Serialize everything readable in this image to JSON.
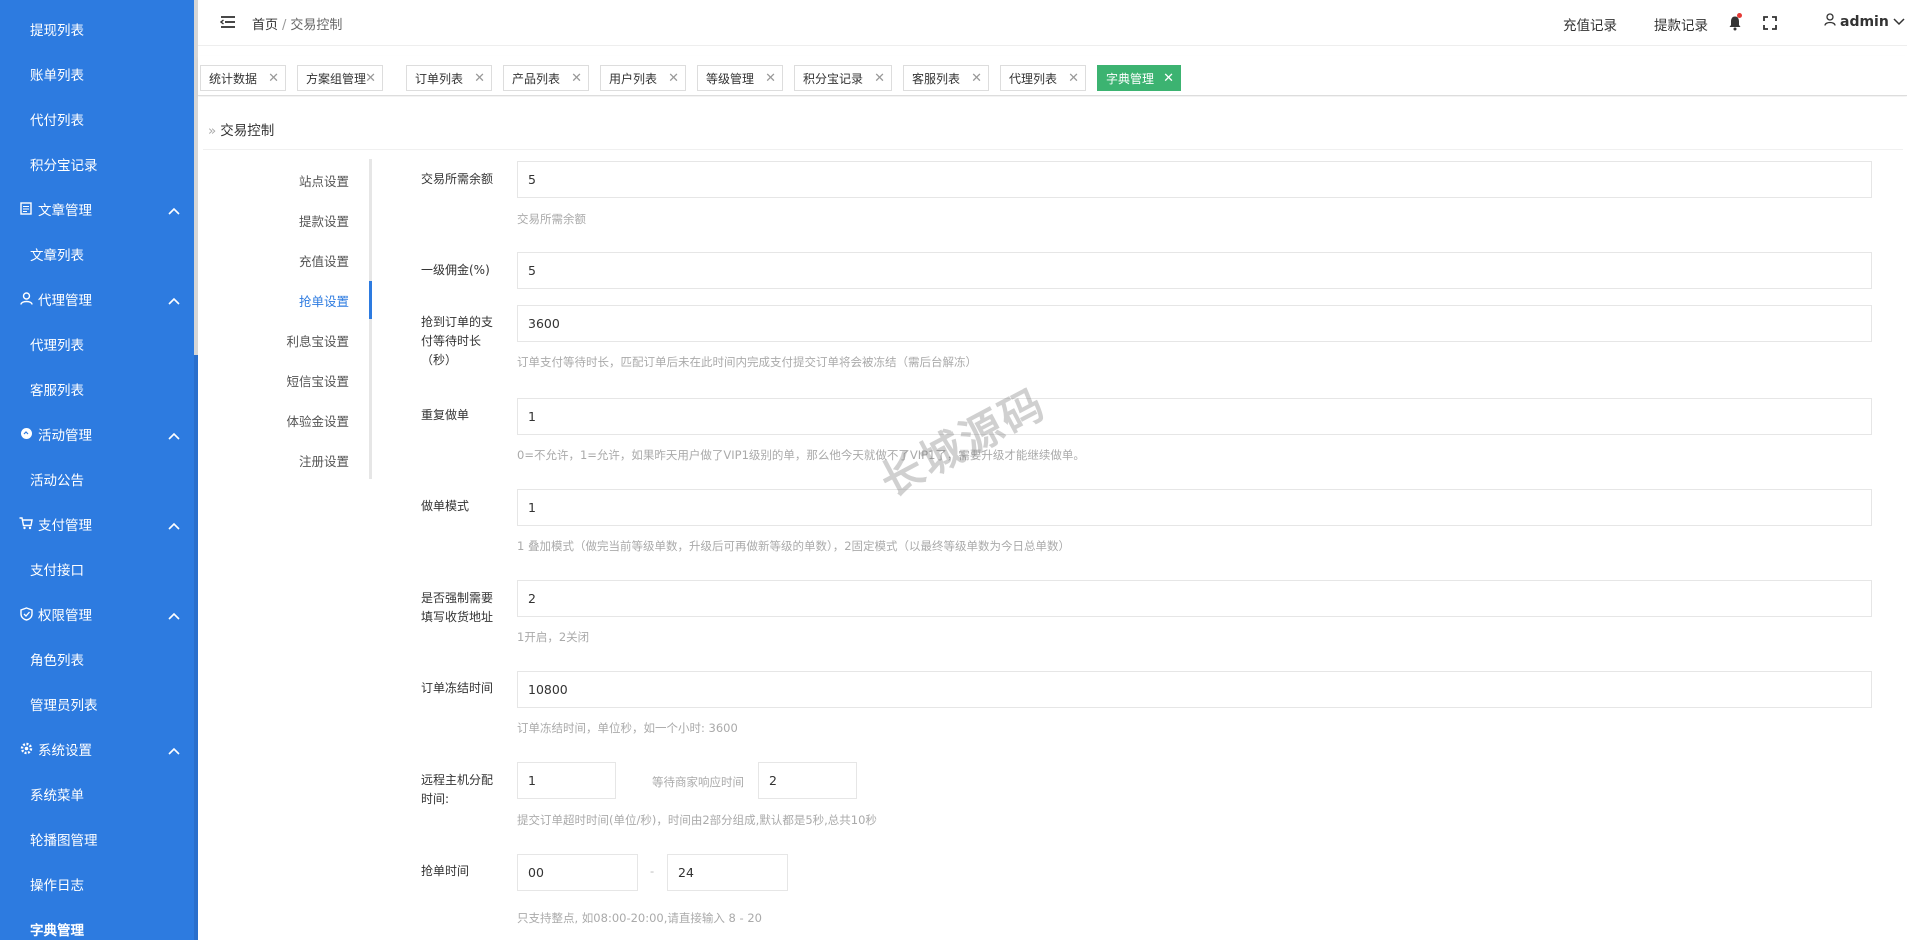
{
  "sidebar": {
    "items": [
      {
        "label": "提现列表",
        "type": "sub"
      },
      {
        "label": "账单列表",
        "type": "sub"
      },
      {
        "label": "代付列表",
        "type": "sub"
      },
      {
        "label": "积分宝记录",
        "type": "sub"
      },
      {
        "label": "文章管理",
        "type": "group",
        "icon": "document-icon"
      },
      {
        "label": "文章列表",
        "type": "sub"
      },
      {
        "label": "代理管理",
        "type": "group",
        "icon": "user-icon"
      },
      {
        "label": "代理列表",
        "type": "sub"
      },
      {
        "label": "客服列表",
        "type": "sub"
      },
      {
        "label": "活动管理",
        "type": "group",
        "icon": "circle-icon"
      },
      {
        "label": "活动公告",
        "type": "sub"
      },
      {
        "label": "支付管理",
        "type": "group",
        "icon": "cart-icon"
      },
      {
        "label": "支付接口",
        "type": "sub"
      },
      {
        "label": "权限管理",
        "type": "group",
        "icon": "shield-icon"
      },
      {
        "label": "角色列表",
        "type": "sub"
      },
      {
        "label": "管理员列表",
        "type": "sub"
      },
      {
        "label": "系统设置",
        "type": "group",
        "icon": "gear-icon"
      },
      {
        "label": "系统菜单",
        "type": "sub"
      },
      {
        "label": "轮播图管理",
        "type": "sub"
      },
      {
        "label": "操作日志",
        "type": "sub"
      },
      {
        "label": "字典管理",
        "type": "sub",
        "active": true
      }
    ]
  },
  "header": {
    "home": "首页",
    "separator": "/",
    "current": "交易控制",
    "recharge_link": "充值记录",
    "withdraw_link": "提款记录",
    "user": "admin"
  },
  "tabs": [
    {
      "label": "统计数据"
    },
    {
      "label": "方案组管理"
    },
    {
      "label": "订单列表"
    },
    {
      "label": "产品列表"
    },
    {
      "label": "用户列表"
    },
    {
      "label": "等级管理"
    },
    {
      "label": "积分宝记录"
    },
    {
      "label": "客服列表"
    },
    {
      "label": "代理列表"
    },
    {
      "label": "字典管理",
      "active": true
    }
  ],
  "page": {
    "section_title": "交易控制",
    "subnav": [
      {
        "label": "站点设置"
      },
      {
        "label": "提款设置"
      },
      {
        "label": "充值设置"
      },
      {
        "label": "抢单设置",
        "active": true
      },
      {
        "label": "利息宝设置"
      },
      {
        "label": "短信宝设置"
      },
      {
        "label": "体验金设置"
      },
      {
        "label": "注册设置"
      }
    ],
    "fields": {
      "min_balance": {
        "label": "交易所需余额",
        "value": "5",
        "help": "交易所需余额"
      },
      "commission": {
        "label": "一级佣金(%)",
        "value": "5"
      },
      "pay_wait": {
        "label_l1": "抢到订单的支",
        "label_l2": "付等待时长",
        "label_l3": "（秒）",
        "value": "3600",
        "help": "订单支付等待时长，匹配订单后未在此时间内完成支付提交订单将会被冻结（需后台解冻）"
      },
      "repeat": {
        "label": "重复做单",
        "value": "1",
        "help": "0=不允许，1=允许，如果昨天用户做了VIP1级别的单，那么他今天就做不了VIP1了，需要升级才能继续做单。"
      },
      "mode": {
        "label": "做单模式",
        "value": "1",
        "help": "1 叠加模式（做完当前等级单数，升级后可再做新等级的单数），2固定模式（以最终等级单数为今日总单数）"
      },
      "address": {
        "label_l1": "是否强制需要",
        "label_l2": "填写收货地址",
        "value": "2",
        "help": "1开启，2关闭"
      },
      "freeze": {
        "label": "订单冻结时间",
        "value": "10800",
        "help": "订单冻结时间，单位秒，如一个小时: 3600"
      },
      "remote": {
        "label_l1": "远程主机分配",
        "label_l2": "时间:",
        "value": "1",
        "wait_label": "等待商家响应时间",
        "wait_value": "2",
        "help": "提交订单超时时间(单位/秒)，时间由2部分组成,默认都是5秒,总共10秒"
      },
      "grab_time": {
        "label": "抢单时间",
        "start": "00",
        "dash": "-",
        "end": "24",
        "help": "只支持整点, 如08:00-20:00,请直接输入 8 - 20"
      }
    }
  },
  "watermark": "长城源码"
}
